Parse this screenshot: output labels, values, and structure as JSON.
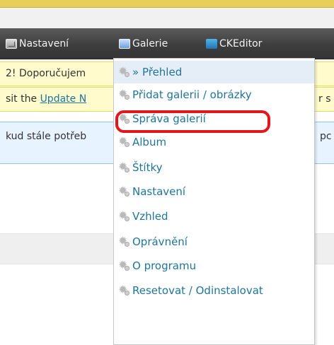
{
  "admin_menu": {
    "items": [
      {
        "label": "Nastavení",
        "icon": "settings-icon"
      },
      {
        "label": "Galerie",
        "icon": "gallery-icon"
      },
      {
        "label": "CKEditor",
        "icon": "ckeditor-icon"
      }
    ]
  },
  "notices": {
    "notice1_text": "2! Doporučujem",
    "notice1_faded": "",
    "notice2_prefix": "sit the ",
    "notice2_link": "Update N",
    "notice2_suffix": "r s",
    "notice3_text": "kud stále potřeb",
    "notice3_faded": "",
    "notice3_end": "pc"
  },
  "galerie_submenu": {
    "items": [
      {
        "label": "» Přehled",
        "current": true
      },
      {
        "label": "Přidat galerii / obrázky"
      },
      {
        "label": "Správa galerií"
      },
      {
        "label": "Album"
      },
      {
        "label": "Štítky"
      },
      {
        "label": "Nastavení"
      },
      {
        "label": "Vzhled"
      },
      {
        "label": "Oprávnění"
      },
      {
        "label": "O programu"
      },
      {
        "label": "Resetovat / Odinstalovat"
      }
    ],
    "highlighted_item": "Přidat galerii / obrázky",
    "highlight_color": "#e1171b"
  },
  "colors": {
    "admin_bar": "#464646",
    "notice_yellow": "#fffbcc",
    "notice_blue": "#e7f3ff",
    "link": "#21759b"
  }
}
